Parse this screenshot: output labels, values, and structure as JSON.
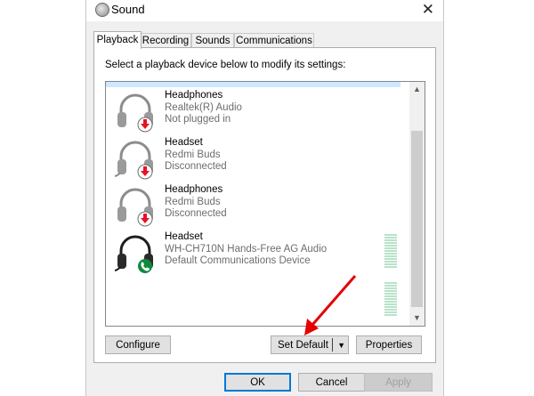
{
  "window": {
    "title": "Sound"
  },
  "tabs": [
    {
      "label": "Playback",
      "active": true
    },
    {
      "label": "Recording",
      "active": false
    },
    {
      "label": "Sounds",
      "active": false
    },
    {
      "label": "Communications",
      "active": false
    }
  ],
  "instruction": "Select a playback device below to modify its settings:",
  "devices": [
    {
      "name": "Headphones",
      "driver": "Realtek(R) Audio",
      "status": "Not plugged in",
      "icon": "headphones-gray-icon",
      "badge": "red-down-arrow-badge"
    },
    {
      "name": "Headset",
      "driver": "Redmi Buds",
      "status": "Disconnected",
      "icon": "headset-gray-icon",
      "badge": "red-down-arrow-badge"
    },
    {
      "name": "Headphones",
      "driver": "Redmi Buds",
      "status": "Disconnected",
      "icon": "headphones-gray-icon",
      "badge": "red-down-arrow-badge"
    },
    {
      "name": "Headset",
      "driver": "WH-CH710N Hands-Free AG Audio",
      "status": "Default Communications Device",
      "icon": "headset-black-icon",
      "badge": "green-phone-badge"
    }
  ],
  "buttons": {
    "configure": "Configure",
    "set_default": "Set Default",
    "properties": "Properties",
    "ok": "OK",
    "cancel": "Cancel",
    "apply": "Apply"
  },
  "colors": {
    "selection": "#cde8ff",
    "disconnected_badge": "#e81123",
    "default_badge": "#10893e",
    "ok_border": "#0078d7",
    "annotation_arrow": "#e60000"
  }
}
